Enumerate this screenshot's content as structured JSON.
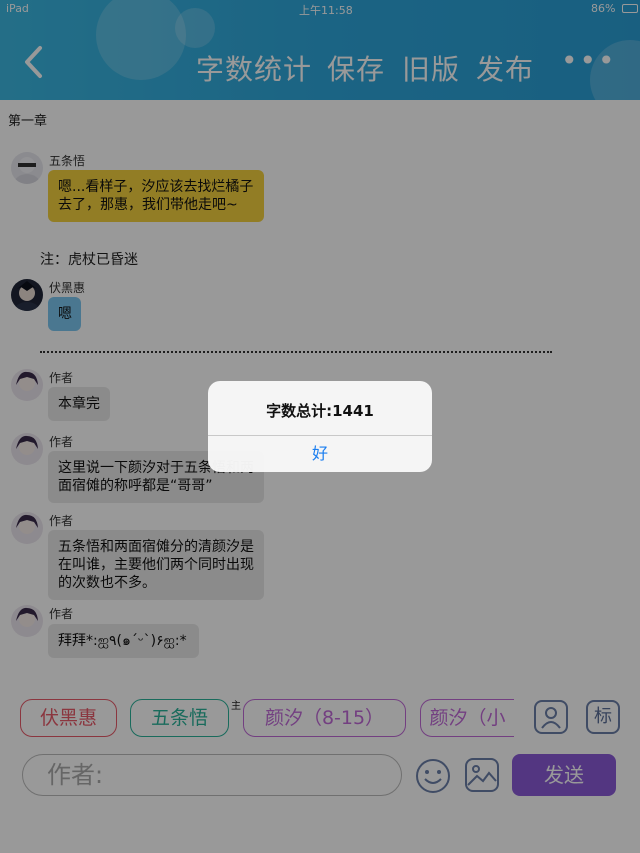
{
  "status": {
    "device": "iPad",
    "time": "上午11:58",
    "battery": "86%"
  },
  "header": {
    "back_icon": "chevron-left-icon",
    "buttons": [
      "字数统计",
      "保存",
      "旧版",
      "发布"
    ],
    "more": "•••"
  },
  "chapter": "第一章",
  "messages": [
    {
      "name": "五条悟",
      "text": "嗯...看样子，汐应该去找烂橘子去了，那惠，我们带他走吧~",
      "color": "#f3d03e"
    },
    {
      "note": "注：虎杖已昏迷"
    },
    {
      "name": "伏黑惠",
      "text": "嗯",
      "color": "#7cc7f0"
    },
    {
      "name": "作者",
      "text": "本章完",
      "color": "#e8e8e8"
    },
    {
      "name": "作者",
      "text": "这里说一下颜汐对于五条悟和两面宿傩的称呼都是“哥哥”",
      "color": "#e8e8e8"
    },
    {
      "name": "作者",
      "text": "五条悟和两面宿傩分的清颜汐是在叫谁，主要他们两个同时出现的次数也不多。",
      "color": "#e8e8e8"
    },
    {
      "name": "作者",
      "text": "拜拜*:ஐ٩(๑´ᵕ`)۶ஐ:*",
      "color": "#e8e8e8"
    }
  ],
  "roles": [
    {
      "label": "伏黑惠",
      "color": "#e85a6a"
    },
    {
      "label": "五条悟",
      "color": "#2bb39a",
      "badge": "主"
    },
    {
      "label": "颜汐（8-15）",
      "color": "#c06ad8"
    },
    {
      "label": "颜汐（小",
      "color": "#c06ad8"
    }
  ],
  "tools": {
    "person_icon": "person-icon",
    "tag_label": "标"
  },
  "input": {
    "placeholder": "作者:"
  },
  "send_label": "发送",
  "dialog": {
    "message": "字数总计:1441",
    "ok": "好"
  }
}
